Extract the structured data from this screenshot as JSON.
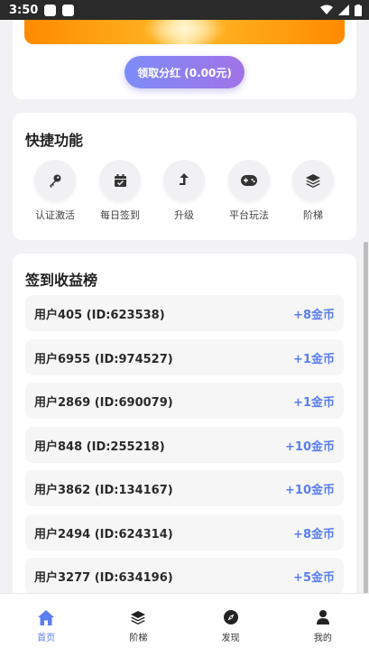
{
  "statusbar": {
    "time": "3:50"
  },
  "top": {
    "claim_button": "领取分红 (0.00元)"
  },
  "quick": {
    "title": "快捷功能",
    "items": [
      {
        "label": "认证激活",
        "icon": "key-icon"
      },
      {
        "label": "每日签到",
        "icon": "calendar-check-icon"
      },
      {
        "label": "升级",
        "icon": "level-up-icon"
      },
      {
        "label": "平台玩法",
        "icon": "gamepad-icon"
      },
      {
        "label": "阶梯",
        "icon": "layers-icon"
      }
    ]
  },
  "ranking": {
    "title": "签到收益榜",
    "rows": [
      {
        "name": "用户405 (ID:623538)",
        "amount": "+8金币"
      },
      {
        "name": "用户6955 (ID:974527)",
        "amount": "+1金币"
      },
      {
        "name": "用户2869 (ID:690079)",
        "amount": "+1金币"
      },
      {
        "name": "用户848 (ID:255218)",
        "amount": "+10金币"
      },
      {
        "name": "用户3862 (ID:134167)",
        "amount": "+10金币"
      },
      {
        "name": "用户2494 (ID:624314)",
        "amount": "+8金币"
      },
      {
        "name": "用户3277 (ID:634196)",
        "amount": "+5金币"
      }
    ]
  },
  "tabbar": {
    "items": [
      {
        "label": "首页",
        "icon": "home-icon",
        "active": true
      },
      {
        "label": "阶梯",
        "icon": "layers-icon",
        "active": false
      },
      {
        "label": "发现",
        "icon": "compass-icon",
        "active": false
      },
      {
        "label": "我的",
        "icon": "user-icon",
        "active": false
      }
    ]
  },
  "colors": {
    "accent": "#5b7ef0",
    "button_start": "#7d8cf7",
    "button_end": "#a173e8"
  }
}
